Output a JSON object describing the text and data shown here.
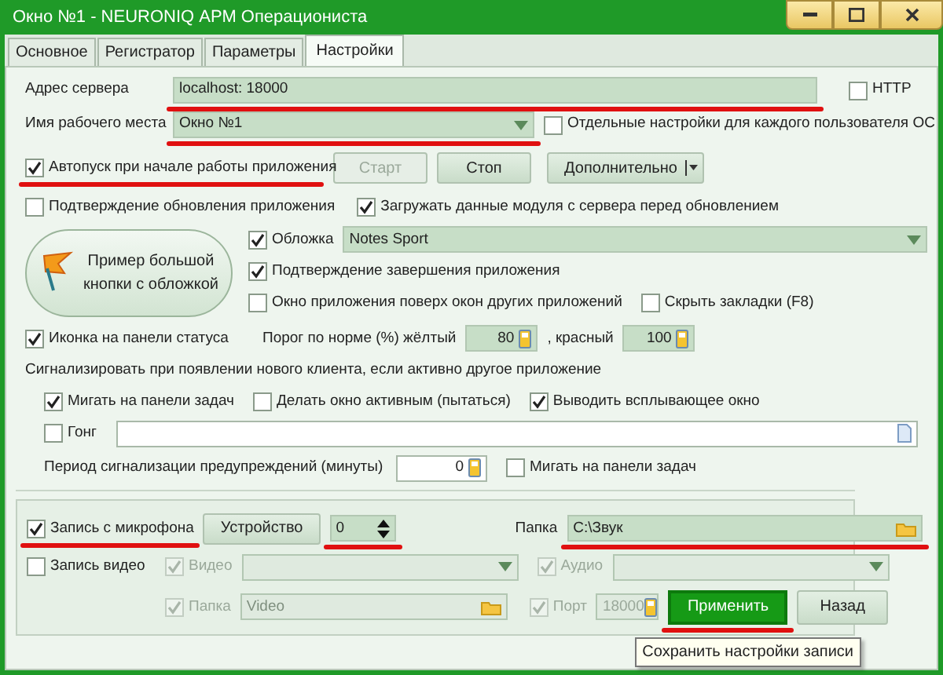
{
  "window": {
    "title": "Окно №1 - NEURONIQ АРМ Операциониста"
  },
  "tabs": [
    {
      "label": "Основное",
      "selected": false
    },
    {
      "label": "Регистратор",
      "selected": false
    },
    {
      "label": "Параметры",
      "selected": false
    },
    {
      "label": "Настройки",
      "selected": true
    }
  ],
  "server": {
    "label": "Адрес сервера",
    "value": "localhost: 18000",
    "annotated": true,
    "http": {
      "label": "HTTP",
      "checked": false
    }
  },
  "workplace": {
    "label": "Имя рабочего места",
    "value": "Окно №1",
    "annotated": true,
    "per_user": {
      "label": "Отдельные настройки для каждого пользователя ОС",
      "checked": false
    }
  },
  "autostart": {
    "label": "Автопуск при начале работы приложения",
    "checked": true,
    "annotated": true
  },
  "service_buttons": [
    {
      "label": "Старт",
      "disabled": true
    },
    {
      "label": "Стоп",
      "disabled": false
    }
  ],
  "more_button": {
    "label": "Дополнительно"
  },
  "update_options": [
    {
      "label": "Подтверждение обновления приложения",
      "checked": false
    },
    {
      "label": "Загружать данные модуля с сервера перед обновлением",
      "checked": true
    }
  ],
  "big_button": {
    "label": "Пример большой кнопки с обложкой"
  },
  "skin": {
    "label": "Обложка",
    "checked": true,
    "value": "Notes Sport"
  },
  "exit_confirm": {
    "label": "Подтверждение завершения приложения",
    "checked": true
  },
  "window_options": [
    {
      "label": "Окно приложения поверх окон других приложений",
      "checked": false
    },
    {
      "label": "Скрыть закладки (F8)",
      "checked": false
    }
  ],
  "status_icon": {
    "label": "Иконка на панели статуса",
    "checked": true
  },
  "threshold": {
    "label": "Порог по норме (%) жёлтый",
    "yellow": "80",
    "red_label": ", красный",
    "red": "100"
  },
  "notify": {
    "label": "Сигнализировать при появлении нового клиента, если активно другое приложение",
    "options": [
      {
        "label": "Мигать на панели задач",
        "checked": true
      },
      {
        "label": "Делать окно активным (пытаться)",
        "checked": false
      },
      {
        "label": "Выводить всплывающее окно",
        "checked": true
      }
    ],
    "gong": {
      "label": "Гонг",
      "checked": false
    }
  },
  "warning_period": {
    "label": "Период сигнализации предупреждений (минуты)",
    "value": "0",
    "blink": {
      "label": "Мигать на панели задач",
      "checked": false
    }
  },
  "recording": {
    "microphone": {
      "label": "Запись с микрофона",
      "checked": true,
      "annotated": true
    },
    "device_button": {
      "label": "Устройство"
    },
    "device_index": {
      "value": "0",
      "annotated": true
    },
    "folder": {
      "label": "Папка",
      "value": "C:\\Звук",
      "annotated": true
    },
    "video": {
      "label": "Запись видео",
      "checked": false
    },
    "video_source": {
      "label": "Видео",
      "checked": true,
      "disabled": true
    },
    "audio_source": {
      "label": "Аудио",
      "checked": true,
      "disabled": true
    },
    "video_folder": {
      "label": "Папка",
      "checked": true,
      "disabled": true,
      "value": "Video"
    },
    "port": {
      "label": "Порт",
      "checked": true,
      "disabled": true,
      "value": "18000"
    },
    "apply_button": {
      "label": "Применить",
      "annotated": true
    },
    "back_button": {
      "label": "Назад"
    },
    "tooltip": {
      "text": "Сохранить настройки записи"
    }
  }
}
